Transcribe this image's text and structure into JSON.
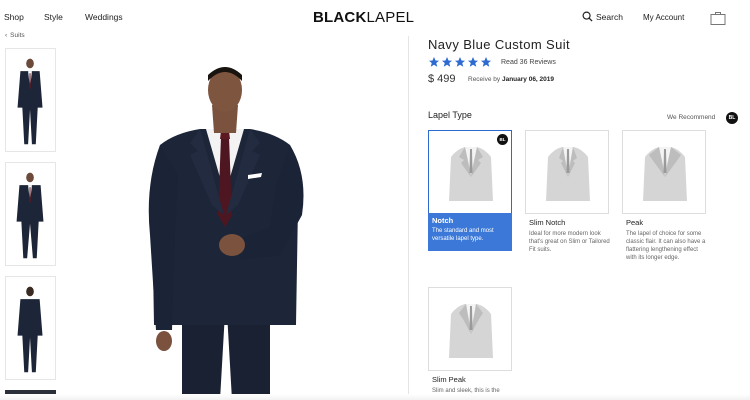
{
  "header": {
    "nav": {
      "shop": "Shop",
      "style": "Style",
      "weddings": "Weddings"
    },
    "logo": {
      "bold": "BLACK",
      "regular": "LAPEL"
    },
    "search_label": "Search",
    "account_label": "My Account",
    "icons": {
      "search": "search-icon",
      "bag": "shopping-bag-icon"
    }
  },
  "gallery": {
    "back_label": "Suits",
    "thumbnails": [
      "front",
      "front-standing",
      "back"
    ]
  },
  "product": {
    "title": "Navy Blue Custom Suit",
    "rating": 5,
    "reviews_label": "Read 36 Reviews",
    "price": "$ 499",
    "receive_prefix": "Receive by",
    "receive_date": "January 06, 2019",
    "suit_color": "#1d2538",
    "star_color": "#2d6bd0"
  },
  "lapel": {
    "heading": "Lapel Type",
    "recommend_label": "We Recommend",
    "badge": "BL",
    "options": [
      {
        "name": "Notch",
        "description": "The standard and most versatile lapel type.",
        "selected": true
      },
      {
        "name": "Slim Notch",
        "description": "Ideal for more modern look that's great on Slim or Tailored Fit suits.",
        "selected": false
      },
      {
        "name": "Peak",
        "description": "The lapel of choice for some classic flair. It can also have a flattering lengthening effect with its longer edge.",
        "selected": false
      },
      {
        "name": "Slim Peak",
        "description": "Slim and sleek, this is the",
        "selected": false
      }
    ],
    "accent_color": "#3b78d8"
  }
}
